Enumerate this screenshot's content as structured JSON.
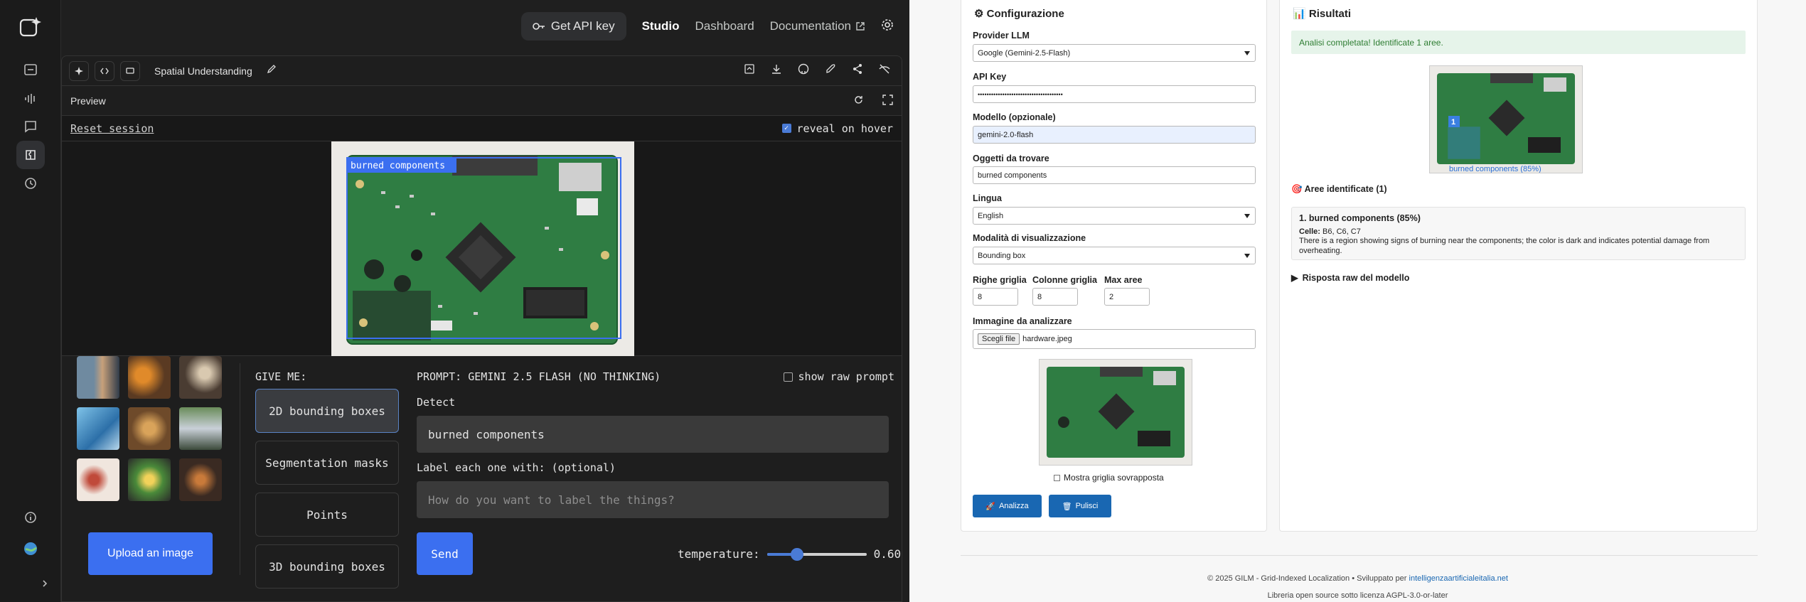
{
  "topbar": {
    "api_key_label": "Get API key",
    "nav": [
      "Studio",
      "Dashboard",
      "Documentation"
    ]
  },
  "rail": {
    "icons": [
      "studio-logo-icon",
      "chat-icon",
      "audio-wave-icon",
      "message-icon",
      "apps-icon",
      "history-icon",
      "info-icon",
      "avatar-icon",
      "expand-icon"
    ]
  },
  "app": {
    "name": "Spatial Understanding",
    "preview_label": "Preview",
    "reset_label": "Reset session",
    "reveal_label": "reveal on hover",
    "reveal_checked": true,
    "detection_label": "burned components",
    "upload_label": "Upload an image",
    "give_me_label": "GIVE ME:",
    "modes": [
      "2D bounding boxes",
      "Segmentation masks",
      "Points",
      "3D bounding boxes"
    ],
    "selected_mode": "2D bounding boxes",
    "prompt_header": "PROMPT: GEMINI 2.5 FLASH (NO THINKING)",
    "show_raw_label": "show raw prompt",
    "show_raw_checked": false,
    "detect_label": "Detect",
    "detect_value": "burned components",
    "label_each_label": "Label each one with: (optional)",
    "label_each_placeholder": "How do you want to label the things?",
    "send_label": "Send",
    "temperature_label": "temperature:",
    "temperature_value": "0.60",
    "temperature_fraction": 0.3
  },
  "config": {
    "title": "Configurazione",
    "provider_label": "Provider LLM",
    "provider_value": "Google (Gemini-2.5-Flash)",
    "api_key_label": "API Key",
    "api_key_value": "••••••••••••••••••••••••••••••••••••••",
    "model_label": "Modello (opzionale)",
    "model_value": "gemini-2.0-flash",
    "objects_label": "Oggetti da trovare",
    "objects_value": "burned components",
    "language_label": "Lingua",
    "language_value": "English",
    "mode_label": "Modalità di visualizzazione",
    "mode_value": "Bounding box",
    "rows_label": "Righe griglia",
    "rows_value": "8",
    "cols_label": "Colonne griglia",
    "cols_value": "8",
    "max_label": "Max aree",
    "max_value": "2",
    "image_label": "Immagine da analizzare",
    "file_button": "Scegli file",
    "file_name": "hardware.jpeg",
    "grid_overlay_label": "Mostra griglia sovrapposta",
    "analyze_label": "Analizza",
    "clear_label": "Pulisci"
  },
  "results": {
    "title": "Risultati",
    "alert": "Analisi completata! Identificate 1 aree.",
    "box_number": "1",
    "caption": "burned components (85%)",
    "areas_header": "Aree identificate (1)",
    "area_title": "1. burned components (85%)",
    "cells_label": "Celle:",
    "cells_value": "B6, C6, C7",
    "description": "There is a region showing signs of burning near the components; the color is dark and indicates potential damage from overheating.",
    "raw_toggle": "Risposta raw del modello"
  },
  "footer": {
    "line1_prefix": "© 2025 GILM - Grid-Indexed Localization • Sviluppato per ",
    "line1_link": "intelligenzaartificialeitalia.net",
    "line2": "Libreria open source sotto licenza AGPL-3.0-or-later"
  },
  "colors": {
    "accent_blue": "#3b6ff0",
    "gilm_blue": "#1967b2",
    "success_green": "#2e7d32",
    "success_bg": "#e6f4ea",
    "pcb_green": "#2f7d43"
  }
}
